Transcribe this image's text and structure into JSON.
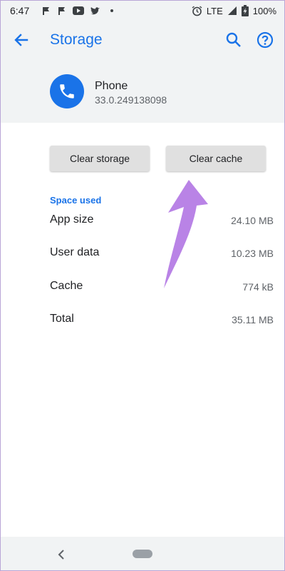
{
  "status_bar": {
    "time": "6:47",
    "network": "LTE",
    "battery": "100%",
    "icons_left": [
      "navigation-flag-icon",
      "navigation-flag-icon",
      "youtube-icon",
      "twitter-icon"
    ]
  },
  "header": {
    "title": "Storage",
    "back_icon": "arrow-left-icon",
    "search_icon": "search-icon",
    "help_icon": "help-circle-icon"
  },
  "app": {
    "name": "Phone",
    "version": "33.0.249138098"
  },
  "actions": {
    "clear_storage": "Clear storage",
    "clear_cache": "Clear cache"
  },
  "storage": {
    "section_title": "Space used",
    "rows": [
      {
        "label": "App size",
        "value": "24.10 MB"
      },
      {
        "label": "User data",
        "value": "10.23 MB"
      },
      {
        "label": "Cache",
        "value": "774 kB"
      },
      {
        "label": "Total",
        "value": "35.11 MB"
      }
    ]
  },
  "colors": {
    "accent": "#1a73e8",
    "header_bg": "#f1f3f4",
    "button_bg": "#e0e0e0",
    "arrow": "#b983e6"
  }
}
